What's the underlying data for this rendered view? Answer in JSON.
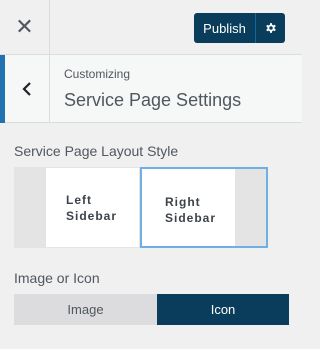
{
  "topbar": {
    "close_icon": "close-icon",
    "publish_label": "Publish",
    "settings_icon": "gear-icon"
  },
  "section": {
    "back_icon": "chevron-left-icon",
    "breadcrumb": "Customizing",
    "title": "Service Page Settings"
  },
  "layout": {
    "label": "Service Page Layout Style",
    "options": [
      {
        "line1": "Left",
        "line2": "Sidebar",
        "selected": false
      },
      {
        "line1": "Right",
        "line2": "Sidebar",
        "selected": true
      }
    ]
  },
  "media": {
    "label": "Image or Icon",
    "options": [
      {
        "label": "Image",
        "selected": false
      },
      {
        "label": "Icon",
        "selected": true
      }
    ]
  },
  "colors": {
    "accent": "#2271b1",
    "primary": "#0a3d5c",
    "selected_border": "#72aee6"
  }
}
